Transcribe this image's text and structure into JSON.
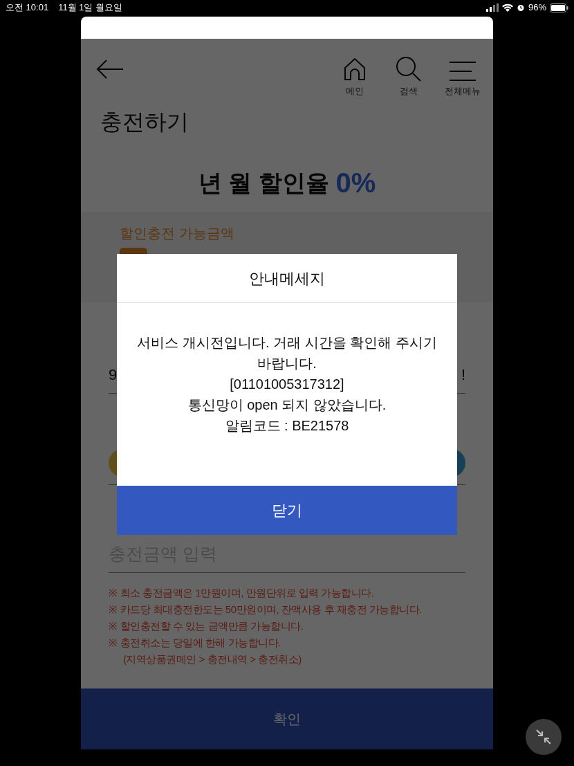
{
  "status_bar": {
    "time": "오전 10:01",
    "date": "11월 1일 월요일",
    "battery": "96%"
  },
  "header": {
    "nav": [
      {
        "kind": "home",
        "label": "메인"
      },
      {
        "kind": "search",
        "label": "검색"
      },
      {
        "kind": "menu",
        "label": "전체메뉴"
      }
    ]
  },
  "page_title": "충전하기",
  "rate": {
    "label": "년 월 할인율",
    "value": "0%"
  },
  "available": {
    "label": "할인충전 가능금액"
  },
  "account": {
    "value": "9",
    "trailing": "!"
  },
  "amount_field": {
    "placeholder": "충전금액 입력"
  },
  "notes": [
    {
      "mark": "※",
      "text": "최소 충전금액은 1만원이며, 만원단위로 입력 가능합니다."
    },
    {
      "mark": "※",
      "text": "카드당 최대충전한도는 50만원이며, 잔액사용 후 재충전 가능합니다."
    },
    {
      "mark": "※",
      "text": "할인충전할 수 있는 금액만큼 가능합니다."
    },
    {
      "mark": "※",
      "text": "충전취소는 당일에 한해 가능합니다.",
      "sub": "(지역상품권메인 > 충전내역 > 충전취소)"
    }
  ],
  "confirm_button": "확인",
  "dialog": {
    "title": "안내메세지",
    "message_lines": [
      "서비스 개시전입니다. 거래 시간을 확인해 주시기 바랍니다.",
      "[01101005317312]",
      "통신망이 open 되지 않았습니다.",
      "알림코드 : BE21578"
    ],
    "button": "닫기"
  }
}
